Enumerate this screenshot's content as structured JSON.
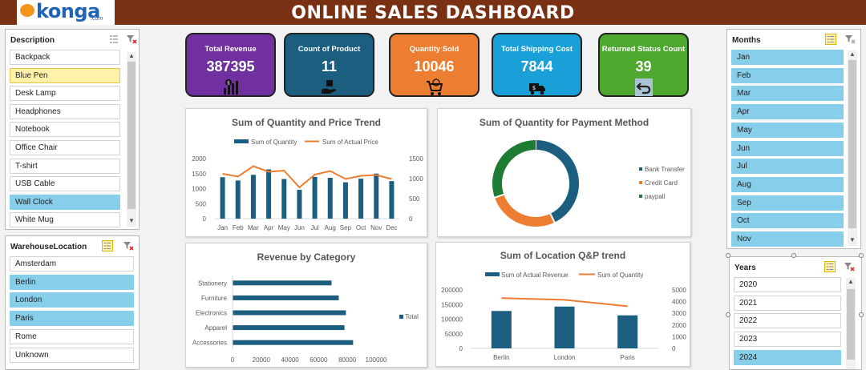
{
  "header": {
    "logo_text": "konga",
    "logo_sub": ".com",
    "title": "ONLINE SALES DASHBOARD"
  },
  "colors": {
    "primary": "#1b5e80",
    "orange": "#ed7d31",
    "green": "#1e7b34",
    "header": "#7a3113",
    "selected": "#87ceeb"
  },
  "slicers": {
    "description": {
      "title": "Description",
      "items": [
        {
          "label": "Backpack",
          "state": "none"
        },
        {
          "label": "Blue Pen",
          "state": "hover"
        },
        {
          "label": "Desk Lamp",
          "state": "none"
        },
        {
          "label": "Headphones",
          "state": "none"
        },
        {
          "label": "Notebook",
          "state": "none"
        },
        {
          "label": "Office Chair",
          "state": "none"
        },
        {
          "label": "T-shirt",
          "state": "none"
        },
        {
          "label": "USB Cable",
          "state": "none"
        },
        {
          "label": "Wall Clock",
          "state": "selected"
        },
        {
          "label": "White Mug",
          "state": "none"
        }
      ]
    },
    "warehouse": {
      "title": "WarehouseLocation",
      "items": [
        {
          "label": "Amsterdam",
          "state": "none"
        },
        {
          "label": "Berlin",
          "state": "selected"
        },
        {
          "label": "London",
          "state": "selected"
        },
        {
          "label": "Paris",
          "state": "selected"
        },
        {
          "label": "Rome",
          "state": "none"
        },
        {
          "label": "Unknown",
          "state": "none"
        }
      ]
    },
    "months": {
      "title": "Months",
      "items": [
        {
          "label": "Jan",
          "state": "selected"
        },
        {
          "label": "Feb",
          "state": "selected"
        },
        {
          "label": "Mar",
          "state": "selected"
        },
        {
          "label": "Apr",
          "state": "selected"
        },
        {
          "label": "May",
          "state": "selected"
        },
        {
          "label": "Jun",
          "state": "selected"
        },
        {
          "label": "Jul",
          "state": "selected"
        },
        {
          "label": "Aug",
          "state": "selected"
        },
        {
          "label": "Sep",
          "state": "selected"
        },
        {
          "label": "Oct",
          "state": "selected"
        },
        {
          "label": "Nov",
          "state": "selected"
        }
      ]
    },
    "years": {
      "title": "Years",
      "items": [
        {
          "label": "2020",
          "state": "none"
        },
        {
          "label": "2021",
          "state": "none"
        },
        {
          "label": "2022",
          "state": "none"
        },
        {
          "label": "2023",
          "state": "none"
        },
        {
          "label": "2024",
          "state": "selected"
        }
      ]
    }
  },
  "kpis": [
    {
      "label": "Total Revenue",
      "value": "387395",
      "color": "#7030a0",
      "icon": "money-chart-icon"
    },
    {
      "label": "Count of Product",
      "value": "11",
      "color": "#1b5e80",
      "icon": "box-hand-icon"
    },
    {
      "label": "Quantity Sold",
      "value": "10046",
      "color": "#ed7d31",
      "icon": "cart-icon"
    },
    {
      "label": "Total Shipping Cost",
      "value": "7844",
      "color": "#1aa0d8",
      "icon": "truck-icon"
    },
    {
      "label": "Returned Status Count",
      "value": "39",
      "color": "#4ea72e",
      "icon": "return-arrow-icon"
    }
  ],
  "chart_data": [
    {
      "type": "bar",
      "title": "Sum of Quantity and Price Trend",
      "categories": [
        "Jan",
        "Feb",
        "Mar",
        "Apr",
        "May",
        "Jun",
        "Jul",
        "Aug",
        "Sep",
        "Oct",
        "Nov",
        "Dec"
      ],
      "series": [
        {
          "name": "Sum of Quantity",
          "type": "bar",
          "axis": "left",
          "values": [
            1380,
            1270,
            1460,
            1640,
            1320,
            960,
            1390,
            1360,
            1210,
            1330,
            1500,
            1250
          ]
        },
        {
          "name": "Sum of Actual Price",
          "type": "line",
          "axis": "right",
          "values": [
            1120,
            1050,
            1310,
            1170,
            1200,
            780,
            1100,
            1190,
            990,
            1070,
            1090,
            990
          ]
        }
      ],
      "ylim": [
        0,
        2000
      ],
      "yticks": [
        "0",
        "500",
        "1000",
        "1500",
        "2000"
      ],
      "y2lim": [
        0,
        1500
      ],
      "y2ticks": [
        "0",
        "500",
        "1000",
        "1500"
      ],
      "legend": "top"
    },
    {
      "type": "pie",
      "title": "Sum of Quantity for Payment Method",
      "categories": [
        "Bank Transfer",
        "Credit Card",
        "paypall"
      ],
      "values": [
        4300,
        2700,
        3046
      ],
      "colors": [
        "#1b5e80",
        "#ed7d31",
        "#1e7b34"
      ],
      "legend": "right"
    },
    {
      "type": "bar",
      "title": "Revenue by Category",
      "orientation": "horizontal",
      "categories": [
        "Stationery",
        "Furniture",
        "Electronics",
        "Apparel",
        "Accessories"
      ],
      "series": [
        {
          "name": "Total",
          "values": [
            69000,
            74000,
            79000,
            78000,
            84000
          ]
        }
      ],
      "xlim": [
        0,
        100000
      ],
      "xticks": [
        "0",
        "20000",
        "40000",
        "60000",
        "80000",
        "100000"
      ],
      "legend": "right"
    },
    {
      "type": "bar",
      "title": "Sum of Location Q&P trend",
      "categories": [
        "Berlin",
        "London",
        "Paris"
      ],
      "series": [
        {
          "name": "Sum of Actual Revenue",
          "type": "bar",
          "axis": "left",
          "values": [
            128000,
            143000,
            113000
          ]
        },
        {
          "name": "Sum of Quantity",
          "type": "line",
          "axis": "right",
          "values": [
            4300,
            4150,
            3600
          ]
        }
      ],
      "ylim": [
        0,
        200000
      ],
      "yticks": [
        "0",
        "50000",
        "100000",
        "150000",
        "200000"
      ],
      "y2lim": [
        0,
        5000
      ],
      "y2ticks": [
        "0",
        "1000",
        "2000",
        "3000",
        "4000",
        "5000"
      ],
      "legend": "top"
    }
  ]
}
